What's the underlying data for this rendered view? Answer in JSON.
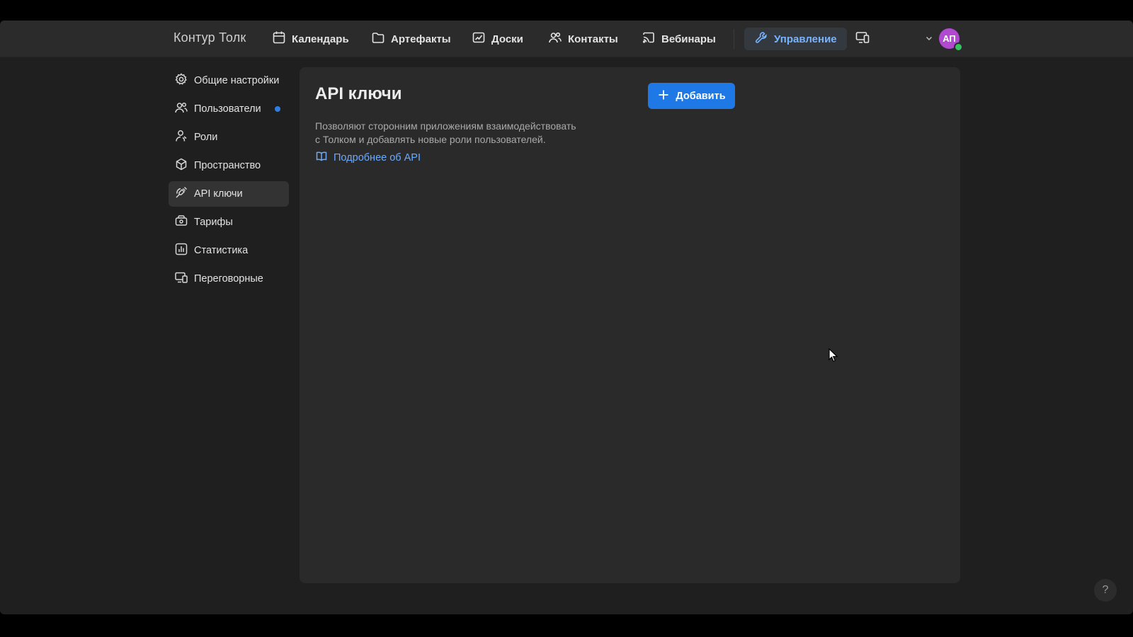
{
  "app": {
    "brand": "Контур Толк"
  },
  "nav": {
    "items": [
      {
        "label": "Календарь",
        "icon": "calendar-icon"
      },
      {
        "label": "Артефакты",
        "icon": "folder-icon"
      },
      {
        "label": "Доски",
        "icon": "board-icon"
      },
      {
        "label": "Контакты",
        "icon": "contacts-icon"
      },
      {
        "label": "Вебинары",
        "icon": "webinar-icon"
      }
    ],
    "active": {
      "label": "Управление",
      "icon": "wrench-icon"
    },
    "devices_icon": "devices-icon",
    "user": {
      "initials": "АП",
      "status": "online"
    }
  },
  "sidebar": {
    "items": [
      {
        "label": "Общие настройки",
        "icon": "gear-icon"
      },
      {
        "label": "Пользователи",
        "icon": "users-icon",
        "badge": "dot"
      },
      {
        "label": "Роли",
        "icon": "roles-icon"
      },
      {
        "label": "Пространство",
        "icon": "cube-icon"
      },
      {
        "label": "API ключи",
        "icon": "plug-icon",
        "active": true
      },
      {
        "label": "Тарифы",
        "icon": "tariff-icon"
      },
      {
        "label": "Статистика",
        "icon": "chart-icon"
      },
      {
        "label": "Переговорные",
        "icon": "meeting-room-icon"
      }
    ]
  },
  "main": {
    "title": "API ключи",
    "add_button": "Добавить",
    "description_line1": "Позволяют сторонним приложениям взаимодействовать",
    "description_line2": "с Толком и добавлять новые роли пользователей.",
    "link": "Подробнее об API"
  },
  "help": {
    "label": "?"
  },
  "colors": {
    "accent": "#1e78e6",
    "link": "#6aaaff",
    "active_nav_text": "#78b3ff",
    "avatar": "#b14ad1",
    "status_online": "#35c45f",
    "badge_dot": "#2f7de1"
  }
}
